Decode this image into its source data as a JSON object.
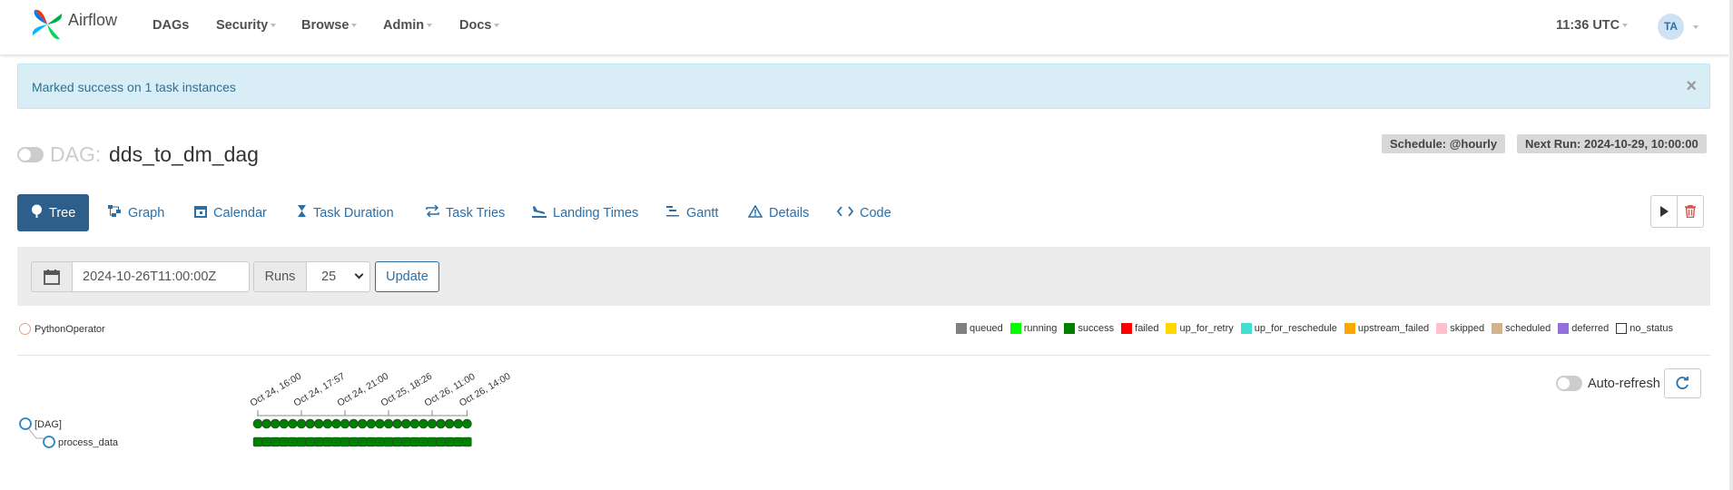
{
  "navbar": {
    "brand": "Airflow",
    "items": [
      {
        "label": "DAGs",
        "caret": false
      },
      {
        "label": "Security",
        "caret": true
      },
      {
        "label": "Browse",
        "caret": true
      },
      {
        "label": "Admin",
        "caret": true
      },
      {
        "label": "Docs",
        "caret": true
      }
    ],
    "time": "11:36 UTC",
    "user_initials": "TA"
  },
  "alert": {
    "message": "Marked success on 1 task instances",
    "close": "×"
  },
  "dag": {
    "label": "DAG:",
    "name": "dds_to_dm_dag",
    "schedule": "Schedule: @hourly",
    "next_run": "Next Run: 2024-10-29, 10:00:00"
  },
  "tabs": [
    {
      "label": "Tree",
      "icon": "tree-icon",
      "active": true
    },
    {
      "label": "Graph",
      "icon": "graph-icon"
    },
    {
      "label": "Calendar",
      "icon": "calendar-icon"
    },
    {
      "label": "Task Duration",
      "icon": "hourglass-icon"
    },
    {
      "label": "Task Tries",
      "icon": "retry-icon"
    },
    {
      "label": "Landing Times",
      "icon": "plane-landing-icon"
    },
    {
      "label": "Gantt",
      "icon": "gantt-icon"
    },
    {
      "label": "Details",
      "icon": "warning-triangle-icon"
    },
    {
      "label": "Code",
      "icon": "code-icon"
    }
  ],
  "filters": {
    "base_date": "2024-10-26T11:00:00Z",
    "runs_label": "Runs",
    "runs_value": "25",
    "update_label": "Update"
  },
  "operator_legend": {
    "label": "PythonOperator",
    "color": "#ffefeb"
  },
  "state_legend": [
    {
      "label": "queued",
      "color": "#808080"
    },
    {
      "label": "running",
      "color": "#00ff00"
    },
    {
      "label": "success",
      "color": "#008000"
    },
    {
      "label": "failed",
      "color": "#ff0000"
    },
    {
      "label": "up_for_retry",
      "color": "#ffd700"
    },
    {
      "label": "up_for_reschedule",
      "color": "#40e0d0"
    },
    {
      "label": "upstream_failed",
      "color": "#ffa500"
    },
    {
      "label": "skipped",
      "color": "#ffc0cb"
    },
    {
      "label": "scheduled",
      "color": "#d2b48c"
    },
    {
      "label": "deferred",
      "color": "#9370db"
    },
    {
      "label": "no_status",
      "color": "#ffffff"
    }
  ],
  "tree": {
    "auto_refresh_label": "Auto-refresh",
    "nodes": [
      "[DAG]",
      "process_data"
    ],
    "date_ticks": [
      "Oct 24, 16:00",
      "Oct 24, 17:57",
      "Oct 24, 21:00",
      "Oct 25, 18:26",
      "Oct 26, 11:00",
      "Oct 26, 14:00"
    ],
    "run_count": 25,
    "run_state": "success",
    "success_color": "#008000"
  }
}
